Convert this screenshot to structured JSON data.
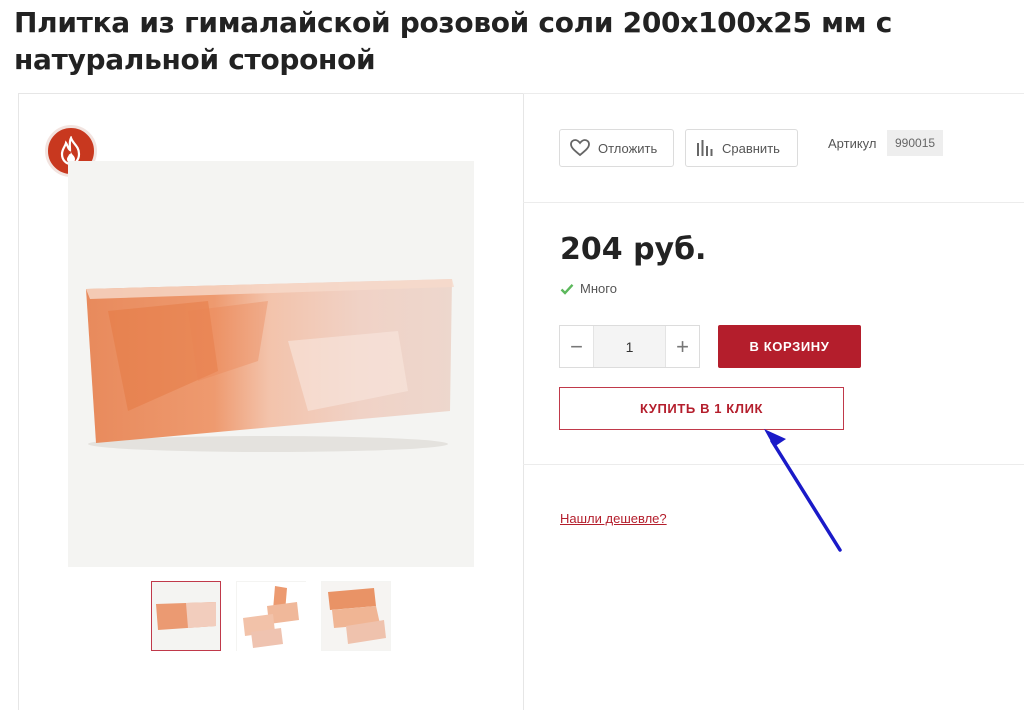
{
  "product": {
    "title": "Плитка из гималайской розовой соли 200х100х25 мм с натуральной стороной",
    "price": "204 руб.",
    "stock": "Много",
    "article_label": "Артикул",
    "article_value": "990015",
    "quantity": "1"
  },
  "actions": {
    "wishlist_label": "Отложить",
    "compare_label": "Сравнить",
    "add_to_cart_label": "В КОРЗИНУ",
    "buy_one_click_label": "КУПИТЬ В 1 КЛИК",
    "found_cheaper_label": "Нашли дешевле?",
    "qty_minus": "−",
    "qty_plus": "+"
  },
  "gallery": {
    "thumbnails": [
      "thumb-1",
      "thumb-2",
      "thumb-3"
    ],
    "active_index": 0
  },
  "badges": [
    "fire-icon"
  ],
  "colors": {
    "accent": "#b41e2c",
    "badge": "#c8381f",
    "stock_check": "#5cb85c",
    "annotation_arrow": "#1a1ac8"
  }
}
